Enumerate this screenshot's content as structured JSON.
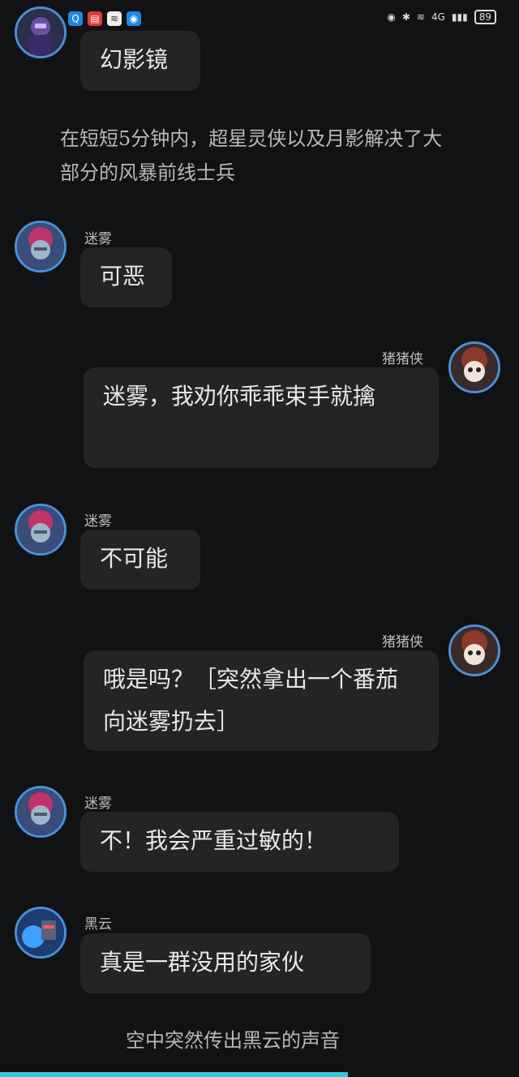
{
  "status_bar": {
    "network": "4G",
    "battery": "89"
  },
  "messages": [
    {
      "speaker": "",
      "text": "幻影镜"
    },
    {
      "narration": "在短短5分钟内，超星灵侠以及月影解决了大部分的风暴前线士兵"
    },
    {
      "speaker": "迷雾",
      "text": "可恶"
    },
    {
      "speaker": "猪猪侠",
      "text": "迷雾，我劝你乖乖束手就擒"
    },
    {
      "speaker": "迷雾",
      "text": "不可能"
    },
    {
      "speaker": "猪猪侠",
      "text": "哦是吗？［突然拿出一个番茄向迷雾扔去］"
    },
    {
      "speaker": "迷雾",
      "text": "不！我会严重过敏的！"
    },
    {
      "speaker": "黑云",
      "text": "真是一群没用的家伙"
    },
    {
      "narration": "空中突然传出黑云的声音"
    }
  ],
  "progress": 0.67
}
